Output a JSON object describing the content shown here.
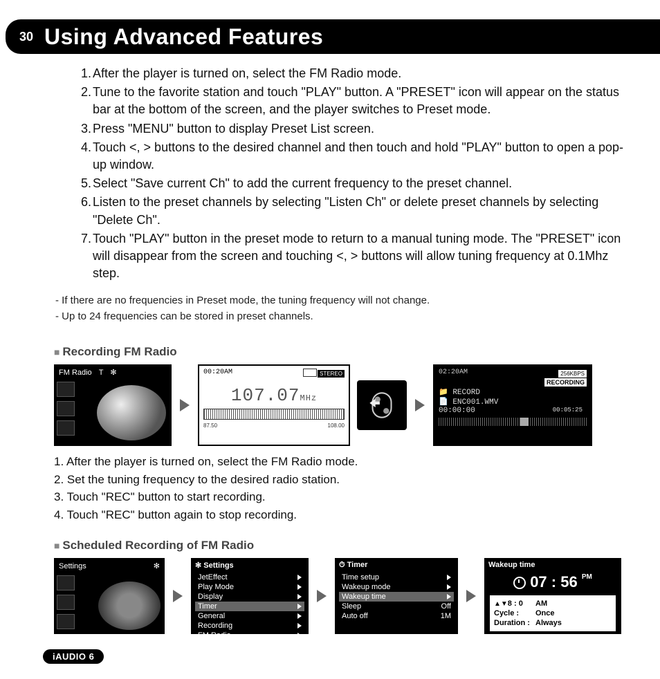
{
  "header": {
    "page_number": "30",
    "title": "Using Advanced Features"
  },
  "preset_steps": [
    "After the player is turned on, select the FM Radio mode.",
    "Tune to the favorite station and touch \"PLAY\" button. A \"PRESET\" icon will appear on the status bar at the bottom of the screen, and the player switches to Preset mode.",
    "Press \"MENU\" button to display Preset List screen.",
    "Touch <, > buttons to the desired channel and then touch and hold \"PLAY\" button to open a pop-up window.",
    "Select \"Save current Ch\" to add the current frequency to the preset channel.",
    "Listen to the preset channels by selecting \"Listen Ch\" or delete preset channels by selecting \"Delete Ch\".",
    "Touch \"PLAY\" button in the preset mode to return to a manual tuning mode. The \"PRESET\" icon will disappear from the screen and touching <, > buttons will allow tuning frequency at 0.1Mhz step."
  ],
  "notes": [
    "- If there are no frequencies in Preset mode, the tuning frequency will not change.",
    "- Up to 24 frequencies can be stored in preset channels."
  ],
  "section_rec": {
    "title": "Recording FM Radio",
    "fm_title": "FM Radio",
    "time_a": "00:20AM",
    "time_b": "02:20AM",
    "stereo": "STEREO",
    "bitrate": "256KBPS",
    "freq": "107.07",
    "freq_unit": "MHz",
    "scale_low": "87.50",
    "scale_high": "108.00",
    "rec_badge": "RECORDING",
    "rec_folder": "RECORD",
    "rec_file": "ENC001.WMV",
    "rec_elapsed": "00:00:00",
    "rec_total": "00:05:25",
    "steps": [
      "After the player is turned on, select the FM Radio mode.",
      "Set the tuning frequency to the desired radio station.",
      "Touch \"REC\" button to start recording.",
      "Touch \"REC\" button again to stop recording."
    ]
  },
  "section_sched": {
    "title": "Scheduled Recording of FM Radio",
    "settings_title": "Settings",
    "settings_menu_hdr": "Settings",
    "settings_items": [
      "JetEffect",
      "Play Mode",
      "Display",
      "Timer",
      "General",
      "Recording",
      "FM Radio"
    ],
    "timer_hdr": "Timer",
    "timer_items": [
      {
        "label": "Time setup",
        "val": ""
      },
      {
        "label": "Wakeup mode",
        "val": ""
      },
      {
        "label": "Wakeup time",
        "val": "",
        "sel": true
      },
      {
        "label": "Sleep",
        "val": "Off"
      },
      {
        "label": "Auto off",
        "val": "1M"
      }
    ],
    "wake_hdr": "Wakeup time",
    "wake_time": "07 : 56",
    "wake_ampm": "PM",
    "wake_rows": [
      {
        "k": "8 :  0",
        "k2": "AM"
      },
      {
        "k": "Cycle :",
        "v": "Once"
      },
      {
        "k": "Duration :",
        "v": "Always"
      }
    ]
  },
  "footer": "iAUDIO 6"
}
